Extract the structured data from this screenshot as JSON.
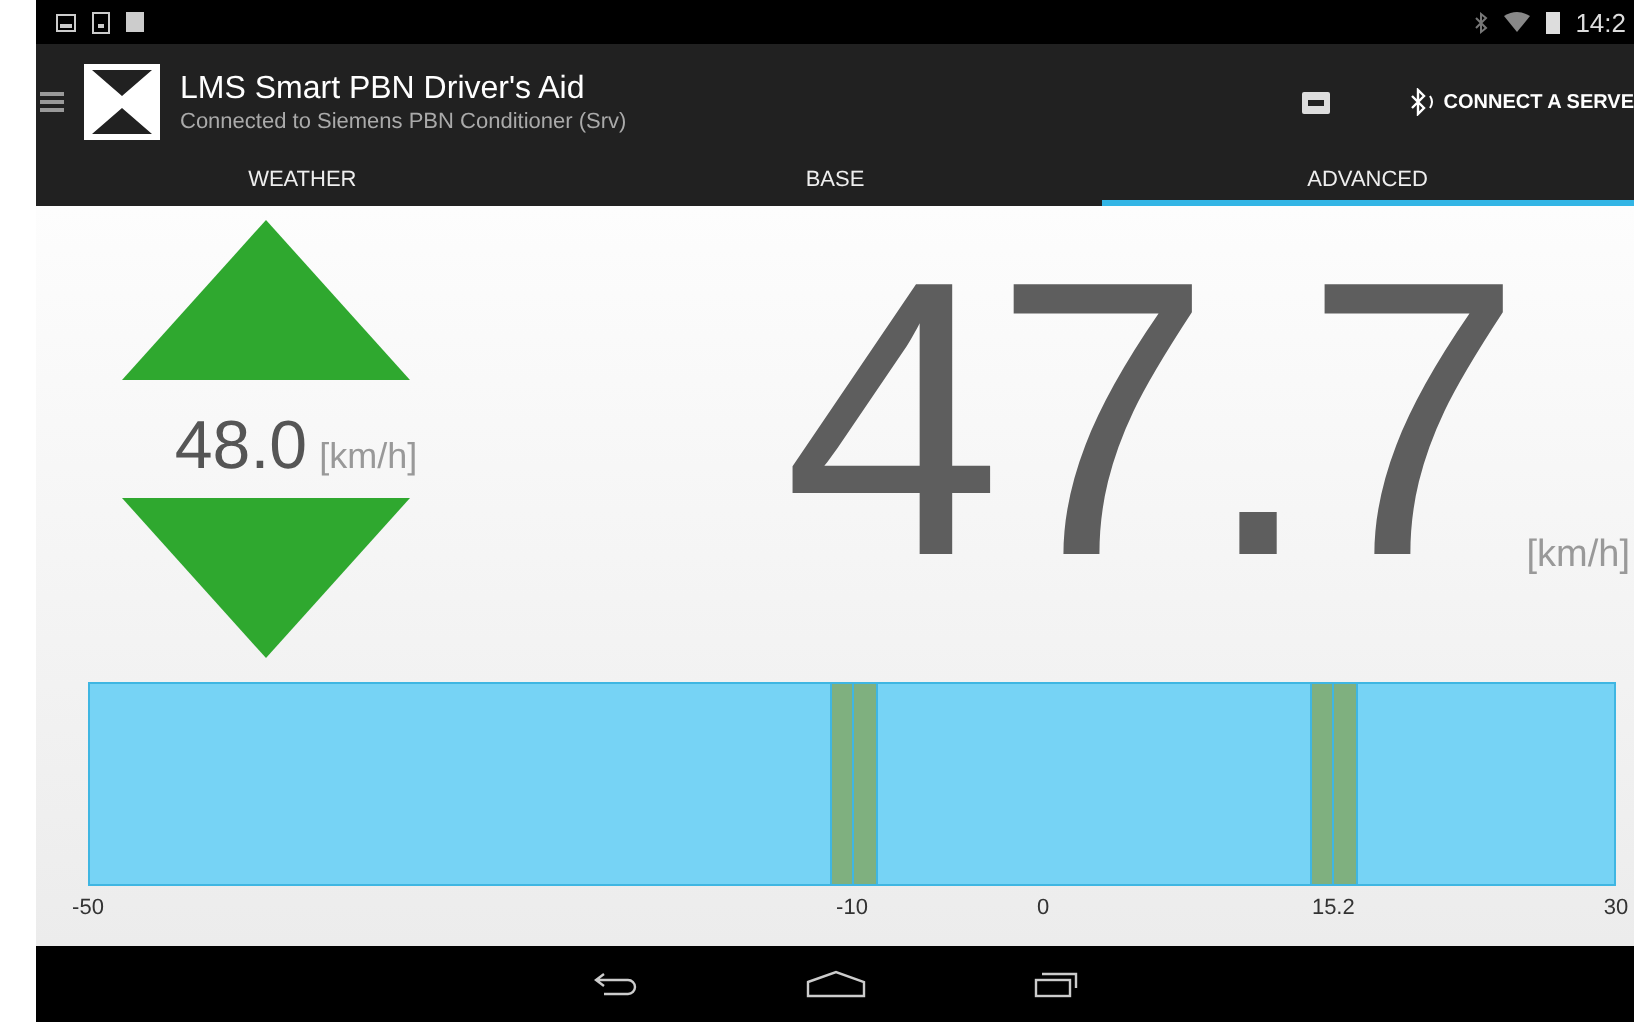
{
  "status_bar": {
    "time": "14:2"
  },
  "app_bar": {
    "title": "LMS Smart PBN Driver's Aid",
    "subtitle": "Connected to Siemens PBN Conditioner (Srv)",
    "action": "CONNECT A SERVE"
  },
  "tabs": [
    {
      "label": "WEATHER",
      "selected": false
    },
    {
      "label": "BASE",
      "selected": false
    },
    {
      "label": "ADVANCED",
      "selected": true
    }
  ],
  "target": {
    "value": "48.0",
    "unit": "[km/h]"
  },
  "speed": {
    "value": "47.7",
    "unit": "[km/h]"
  },
  "scale": {
    "ticks": [
      {
        "label": "-50",
        "marked": false
      },
      {
        "label": "-10",
        "marked": true
      },
      {
        "label": "0",
        "marked": false
      },
      {
        "label": "15.2",
        "marked": true
      },
      {
        "label": "30",
        "marked": false
      }
    ]
  }
}
